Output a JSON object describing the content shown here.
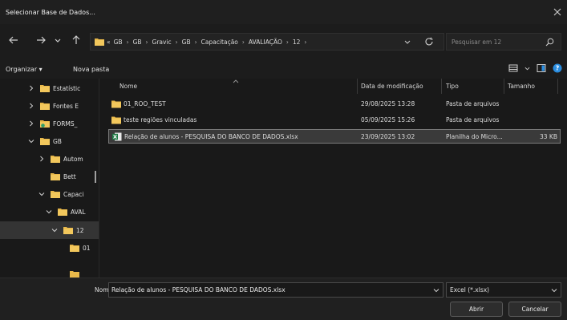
{
  "window": {
    "title": "Selecionar Base de Dados..."
  },
  "address": {
    "crumbs": [
      "«",
      "GB",
      "GB",
      "Gravic",
      "GB",
      "Capacitação",
      "AVALIAÇÃO",
      "12"
    ],
    "separator": "›"
  },
  "search": {
    "placeholder": "Pesquisar em 12"
  },
  "toolbar": {
    "organize_label": "Organizar ▾",
    "new_folder_label": "Nova pasta"
  },
  "sidebar": {
    "items": [
      {
        "label": "Estatístic",
        "expanded": false
      },
      {
        "label": "Fontes E",
        "expanded": false
      },
      {
        "label": "FORMS_",
        "expanded": false
      },
      {
        "label": "GB",
        "expanded": true
      },
      {
        "label": "Autom",
        "expanded": false
      },
      {
        "label": "Bett",
        "expanded": null
      },
      {
        "label": "Capaci",
        "expanded": true
      },
      {
        "label": "AVAL",
        "expanded": true
      },
      {
        "label": "12",
        "expanded": true,
        "selected": true
      },
      {
        "label": "01",
        "expanded": null
      }
    ]
  },
  "columns": {
    "name": "Nome",
    "modified": "Data de modificação",
    "type": "Tipo",
    "size": "Tamanho"
  },
  "files": [
    {
      "name": "01_ROO_TEST",
      "modified": "29/08/2025 13:28",
      "type": "Pasta de arquivos",
      "size": "",
      "icon": "folder-icon"
    },
    {
      "name": "teste regiões vinculadas",
      "modified": "05/09/2025 15:26",
      "type": "Pasta de arquivos",
      "size": "",
      "icon": "folder-icon"
    },
    {
      "name": "Relação de alunos - PESQUISA DO BANCO DE DADOS.xlsx",
      "modified": "23/09/2025 13:02",
      "type": "Planilha do Micro...",
      "size": "33 KB",
      "icon": "excel-file-icon",
      "selected": true
    }
  ],
  "footer": {
    "filename_label": "Nome:",
    "filename_value": "Relação de alunos - PESQUISA DO BANCO DE DADOS.xlsx",
    "filter_value": "Excel (*.xlsx)",
    "open_label": "Abrir",
    "cancel_label": "Cancelar"
  },
  "colors": {
    "background": "#191919",
    "folder": "#e8b84a",
    "excel": "#1f7a45",
    "help": "#2a8de0",
    "selection": "#3a3a3a"
  }
}
